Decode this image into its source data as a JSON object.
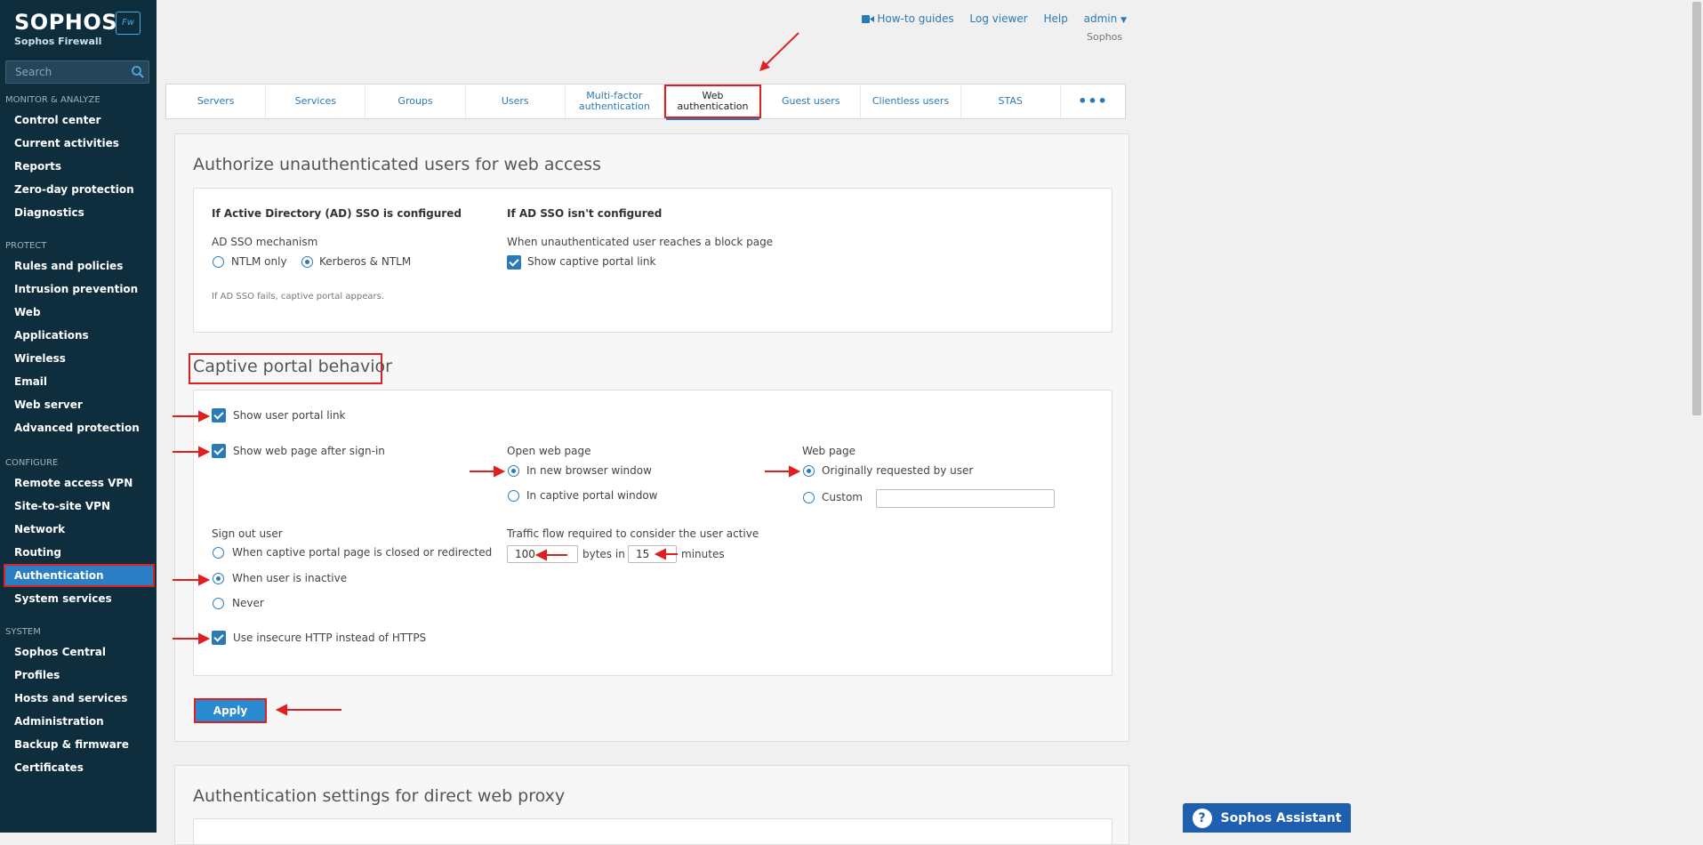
{
  "brand": {
    "name": "SOPHOS",
    "subtitle": "Sophos Firewall",
    "badge": "Fw"
  },
  "search": {
    "placeholder": "Search"
  },
  "nav": {
    "monitor": {
      "header": "MONITOR & ANALYZE",
      "items": [
        "Control center",
        "Current activities",
        "Reports",
        "Zero-day protection",
        "Diagnostics"
      ]
    },
    "protect": {
      "header": "PROTECT",
      "items": [
        "Rules and policies",
        "Intrusion prevention",
        "Web",
        "Applications",
        "Wireless",
        "Email",
        "Web server",
        "Advanced protection"
      ]
    },
    "configure": {
      "header": "CONFIGURE",
      "items": [
        "Remote access VPN",
        "Site-to-site VPN",
        "Network",
        "Routing",
        "Authentication",
        "System services"
      ]
    },
    "system": {
      "header": "SYSTEM",
      "items": [
        "Sophos Central",
        "Profiles",
        "Hosts and services",
        "Administration",
        "Backup & firmware",
        "Certificates"
      ]
    }
  },
  "topbar": {
    "howto": "How-to guides",
    "logviewer": "Log viewer",
    "help": "Help",
    "user": "admin",
    "device": "Sophos"
  },
  "tabs": [
    "Servers",
    "Services",
    "Groups",
    "Users",
    "Multi-factor authentication",
    "Web authentication",
    "Guest users",
    "Clientless users",
    "STAS",
    "•••"
  ],
  "section1": {
    "title": "Authorize unauthenticated users for web access",
    "ad_configured": "If Active Directory (AD) SSO is configured",
    "mechanism_label": "AD SSO mechanism",
    "ntlm_only": "NTLM only",
    "kerberos": "Kerberos & NTLM",
    "fail_note": "If AD SSO fails, captive portal appears.",
    "ad_not_configured": "If AD SSO isn't configured",
    "block_page_label": "When unauthenticated user reaches a block page",
    "show_captive_link": "Show captive portal link"
  },
  "section2": {
    "title": "Captive portal behavior",
    "show_user_portal": "Show user portal link",
    "show_web_page": "Show web page after sign-in",
    "open_web_page": "Open web page",
    "new_window": "In new browser window",
    "captive_window": "In captive portal window",
    "web_page": "Web page",
    "originally_requested": "Originally requested by user",
    "custom": "Custom",
    "sign_out": "Sign out user",
    "when_closed": "When captive portal page is closed or redirected",
    "when_inactive": "When user is inactive",
    "never": "Never",
    "traffic_label": "Traffic flow required to consider the user active",
    "bytes_value": "100",
    "bytes_in": "bytes in",
    "minutes_value": "15",
    "minutes": "minutes",
    "use_http": "Use insecure HTTP instead of HTTPS",
    "apply": "Apply"
  },
  "section3": {
    "title": "Authentication settings for direct web proxy"
  },
  "assistant": {
    "label": "Sophos Assistant"
  }
}
